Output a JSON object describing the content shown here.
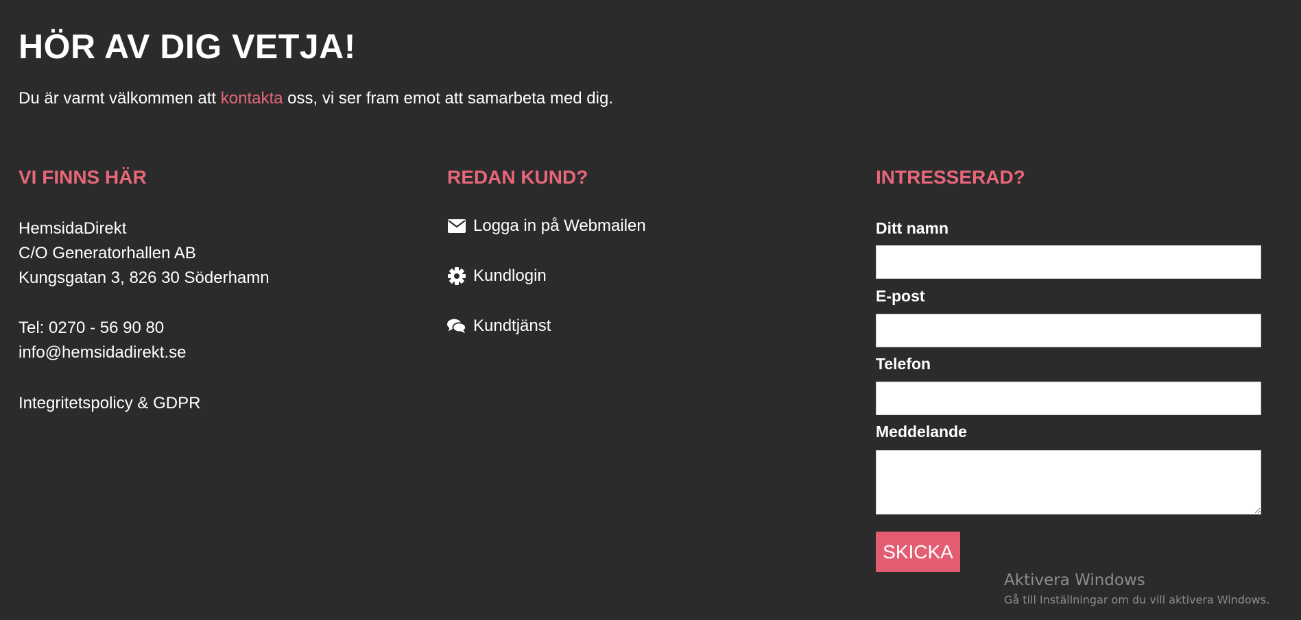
{
  "heading": "HÖR AV DIG VETJA!",
  "intro": {
    "before": "Du är varmt välkommen att ",
    "link": "kontakta",
    "after": " oss, vi ser fram emot att samarbeta med dig."
  },
  "columns": {
    "location": {
      "title": "VI FINNS HÄR",
      "company": "HemsidaDirekt",
      "co": "C/O Generatorhallen AB",
      "street": "Kungsgatan 3, 826 30 Söderhamn",
      "phone": "Tel: 0270 - 56 90 80",
      "email": "info@hemsidadirekt.se",
      "privacy": "Integritetspolicy & GDPR"
    },
    "customer": {
      "title": "REDAN KUND?",
      "items": [
        {
          "label": "Logga in på Webmailen",
          "icon": "envelope-icon"
        },
        {
          "label": "Kundlogin",
          "icon": "gear-icon"
        },
        {
          "label": "Kundtjänst",
          "icon": "comments-icon"
        }
      ]
    },
    "interested": {
      "title": "INTRESSERAD?",
      "form": {
        "name_label": "Ditt namn",
        "name_value": "",
        "email_label": "E-post",
        "email_value": "",
        "phone_label": "Telefon",
        "phone_value": "",
        "message_label": "Meddelande",
        "message_value": "",
        "submit_label": "SKICKA"
      }
    }
  },
  "watermark": {
    "title": "Aktivera Windows",
    "subtitle": "Gå till Inställningar om du vill aktivera Windows."
  },
  "colors": {
    "background": "#2b2b2b",
    "accent": "#e8677a",
    "button": "#e35d72",
    "text": "#ffffff"
  }
}
